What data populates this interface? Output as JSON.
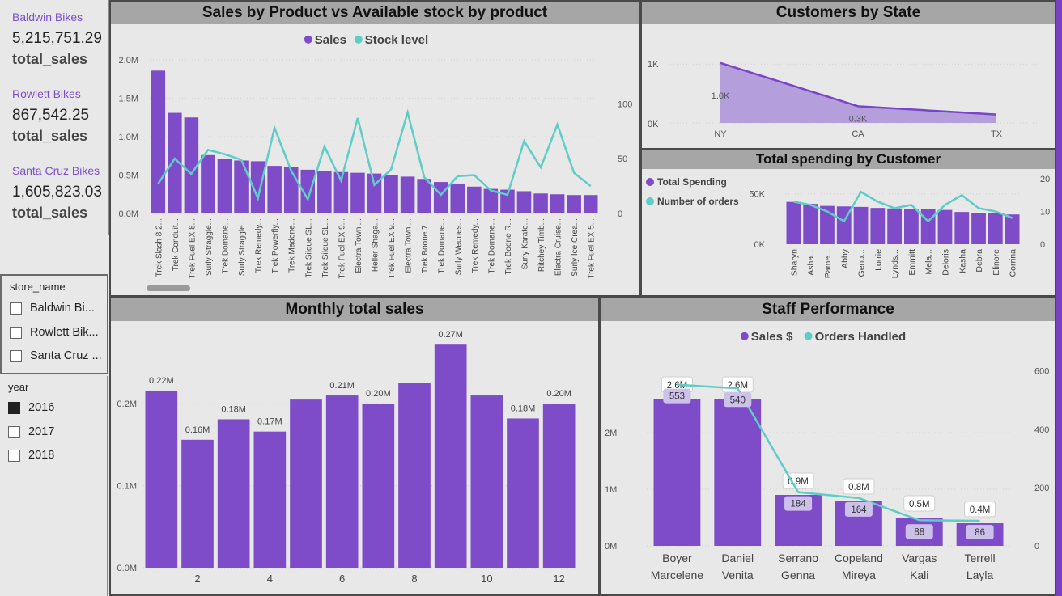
{
  "colors": {
    "sales": "#7e4cc9",
    "stock": "#5ecdc7",
    "axis_text": "#555555",
    "title_bar": "#a6a6a6"
  },
  "cards": [
    {
      "store": "Baldwin Bikes",
      "value": "5,215,751.29",
      "label": "total_sales"
    },
    {
      "store": "Rowlett Bikes",
      "value": "867,542.25",
      "label": "total_sales"
    },
    {
      "store": "Santa Cruz Bikes",
      "value": "1,605,823.03",
      "label": "total_sales"
    }
  ],
  "store_slicer": {
    "title": "store_name",
    "items": [
      {
        "label": "Baldwin Bi...",
        "checked": false
      },
      {
        "label": "Rowlett Bik...",
        "checked": false
      },
      {
        "label": "Santa Cruz ...",
        "checked": false
      }
    ]
  },
  "year_slicer": {
    "title": "year",
    "items": [
      {
        "label": "2016",
        "checked": true
      },
      {
        "label": "2017",
        "checked": false
      },
      {
        "label": "2018",
        "checked": false
      }
    ]
  },
  "chart_data": [
    {
      "id": "sales-vs-stock",
      "type": "bar",
      "title": "Sales by Product vs Available stock by product",
      "legend": [
        "Sales",
        "Stock level"
      ],
      "legend_position": "top-center",
      "categories": [
        "Trek Slash 8 2...",
        "Trek Conduit...",
        "Trek Fuel EX 8...",
        "Surly Straggle...",
        "Trek Domane...",
        "Surly Straggle...",
        "Trek Remedy...",
        "Trek Powerfly...",
        "Trek Madone...",
        "Trek Silque SL...",
        "Trek Silque SL...",
        "Trek Fuel EX 9...",
        "Electra Towni...",
        "Heller Shaga...",
        "Trek Fuel EX 9...",
        "Electra Towni...",
        "Trek Boone 7...",
        "Trek Domane...",
        "Surly Wednes...",
        "Trek Remedy...",
        "Trek Domane...",
        "Trek Boone R...",
        "Surly Karate...",
        "Ritchey Timb...",
        "Electra Cruise...",
        "Surly Ice Crea...",
        "Trek Fuel EX 5..."
      ],
      "series": [
        {
          "name": "Sales",
          "type": "bar",
          "values": [
            1.86,
            1.31,
            1.25,
            0.76,
            0.71,
            0.69,
            0.68,
            0.62,
            0.6,
            0.57,
            0.55,
            0.54,
            0.53,
            0.52,
            0.5,
            0.48,
            0.45,
            0.41,
            0.39,
            0.35,
            0.32,
            0.31,
            0.29,
            0.26,
            0.25,
            0.24,
            0.24
          ]
        },
        {
          "name": "Stock level",
          "type": "line",
          "values": [
            27,
            50,
            36,
            58,
            54,
            49,
            14,
            78,
            39,
            13,
            61,
            30,
            87,
            26,
            40,
            92,
            33,
            17,
            34,
            35,
            21,
            17,
            66,
            42,
            81,
            37,
            25
          ]
        }
      ],
      "y_left": {
        "ticks": [
          "0.0M",
          "0.5M",
          "1.0M",
          "1.5M",
          "2.0M"
        ],
        "range": [
          0,
          2.0
        ]
      },
      "y_right": {
        "ticks": [
          "0",
          "50",
          "100"
        ],
        "range": [
          0,
          140
        ]
      }
    },
    {
      "id": "customers-by-state",
      "type": "area",
      "title": "Customers by State",
      "categories": [
        "NY",
        "CA",
        "TX"
      ],
      "values": [
        1019,
        284,
        142
      ],
      "data_labels": [
        "1.0K",
        "0.3K",
        ""
      ],
      "y_ticks": [
        "0K",
        "1K"
      ],
      "range": [
        0,
        1100
      ]
    },
    {
      "id": "spending-by-customer",
      "type": "bar",
      "title": "Total spending by Customer",
      "legend": [
        "Total Spending",
        "Number of orders"
      ],
      "legend_position": "left",
      "categories": [
        "Sharyn",
        "Asha...",
        "Pame...",
        "Abby",
        "Geno...",
        "Lorrie",
        "Lynds...",
        "Emmitt",
        "Mela...",
        "Deloris",
        "Kasha",
        "Debra",
        "Elinore",
        "Corrina"
      ],
      "series": [
        {
          "name": "Total Spending",
          "type": "bar",
          "values": [
            42000,
            40000,
            38000,
            37500,
            37000,
            36000,
            35500,
            35000,
            34500,
            34000,
            32000,
            31000,
            30500,
            29500
          ]
        },
        {
          "name": "Number of orders",
          "type": "line",
          "values": [
            13,
            12,
            10,
            7,
            16,
            13,
            11,
            12,
            7,
            12,
            15,
            11,
            10,
            8
          ]
        }
      ],
      "y_left": {
        "ticks": [
          "0K",
          "50K"
        ],
        "range": [
          0,
          65000
        ]
      },
      "y_right": {
        "ticks": [
          "0",
          "10",
          "20"
        ],
        "range": [
          0,
          20
        ]
      }
    },
    {
      "id": "monthly-total-sales",
      "type": "bar",
      "title": "Monthly total sales",
      "categories": [
        "1",
        "2",
        "3",
        "4",
        "5",
        "6",
        "7",
        "8",
        "9",
        "10",
        "11",
        "12"
      ],
      "x_tick_labels": [
        "",
        "2",
        "",
        "4",
        "",
        "6",
        "",
        "8",
        "",
        "10",
        "",
        "12"
      ],
      "values": [
        0.216,
        0.156,
        0.181,
        0.166,
        0.205,
        0.21,
        0.2,
        0.225,
        0.272,
        0.21,
        0.182,
        0.2
      ],
      "data_labels": [
        "0.22M",
        "0.16M",
        "0.18M",
        "0.17M",
        "",
        "0.21M",
        "0.20M",
        "",
        "0.27M",
        "",
        "0.18M",
        "0.20M"
      ],
      "y_ticks": [
        "0.0M",
        "0.1M",
        "0.2M"
      ],
      "ylim": [
        0,
        0.285
      ]
    },
    {
      "id": "staff-performance",
      "type": "bar",
      "title": "Staff Performance",
      "legend": [
        "Sales $",
        "Orders Handled"
      ],
      "legend_position": "top-center",
      "categories": [
        "Boyer\nMarcelene",
        "Daniel\nVenita",
        "Serrano\nGenna",
        "Copeland\nMireya",
        "Vargas\nKali",
        "Terrell\nLayla"
      ],
      "series": [
        {
          "name": "Sales $",
          "type": "bar",
          "values": [
            2.6,
            2.6,
            0.9,
            0.8,
            0.5,
            0.4
          ],
          "labels": [
            "2.6M",
            "2.6M",
            "0.9M",
            "0.8M",
            "0.5M",
            "0.4M"
          ]
        },
        {
          "name": "Orders Handled",
          "type": "line",
          "values": [
            553,
            540,
            184,
            164,
            88,
            86
          ]
        }
      ],
      "y_left": {
        "ticks": [
          "0M",
          "1M",
          "2M"
        ],
        "range": [
          0,
          3.4
        ]
      },
      "y_right": {
        "ticks": [
          "0",
          "200",
          "400",
          "600"
        ],
        "range": [
          0,
          660
        ]
      }
    }
  ]
}
